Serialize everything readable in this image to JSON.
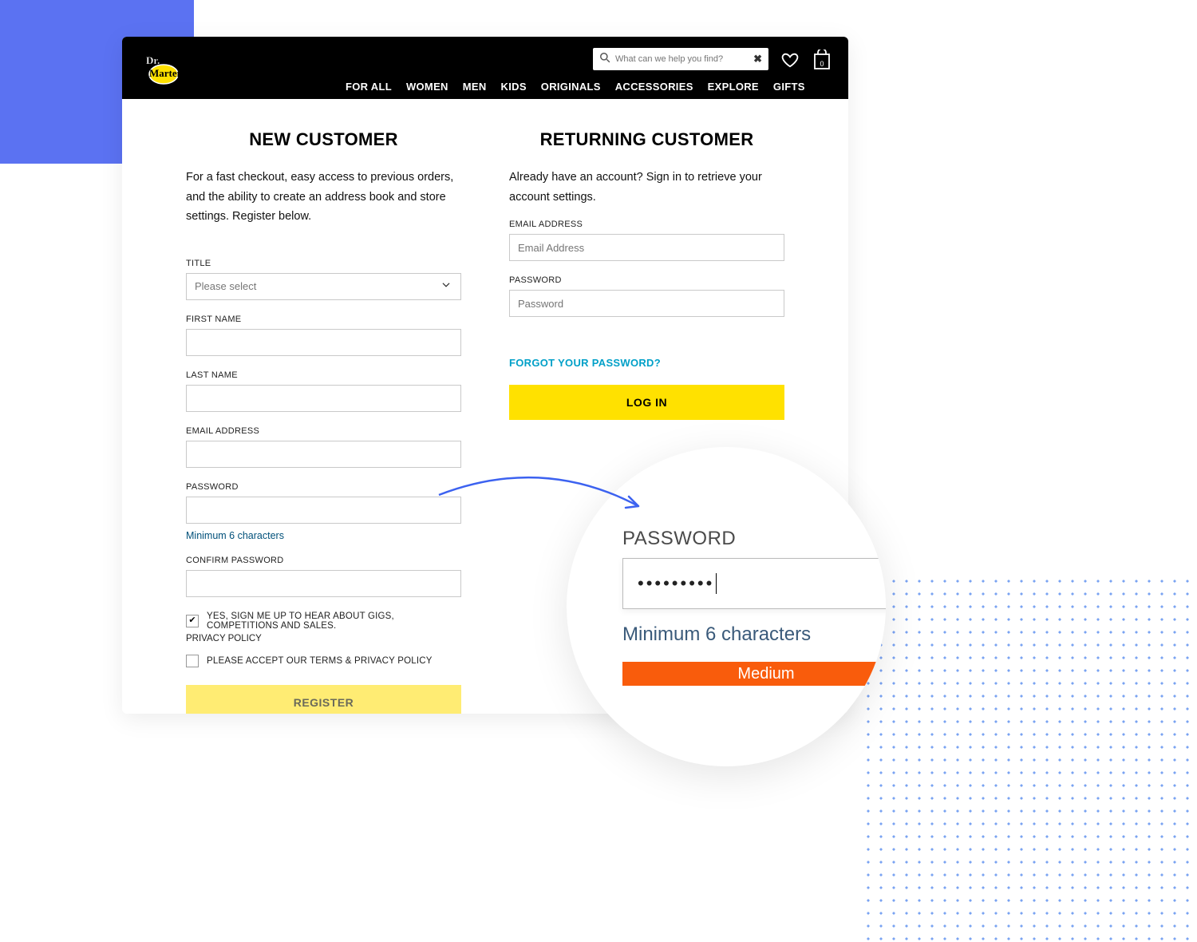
{
  "header": {
    "search_placeholder": "What can we help you find?",
    "bag_count": "0",
    "nav": [
      "FOR ALL",
      "WOMEN",
      "MEN",
      "KIDS",
      "ORIGINALS",
      "ACCESSORIES",
      "EXPLORE",
      "GIFTS"
    ]
  },
  "new_customer": {
    "title": "NEW CUSTOMER",
    "intro": "For a fast checkout, easy access to previous orders, and the ability to create an address book and store settings. Register below.",
    "fields": {
      "title_label": "TITLE",
      "title_placeholder": "Please select",
      "first_name_label": "FIRST NAME",
      "last_name_label": "LAST NAME",
      "email_label": "EMAIL ADDRESS",
      "password_label": "PASSWORD",
      "password_helper": "Minimum 6 characters",
      "confirm_password_label": "CONFIRM PASSWORD"
    },
    "checkbox_marketing": "YES, SIGN ME UP TO HEAR ABOUT GIGS, COMPETITIONS AND SALES.",
    "privacy_label": "PRIVACY POLICY",
    "checkbox_terms": "PLEASE ACCEPT OUR TERMS & PRIVACY POLICY",
    "register_button": "REGISTER"
  },
  "returning_customer": {
    "title": "RETURNING CUSTOMER",
    "intro": "Already have an account? Sign in to retrieve your account settings.",
    "email_label": "EMAIL ADDRESS",
    "email_placeholder": "Email Address",
    "password_label": "PASSWORD",
    "password_placeholder": "Password",
    "forgot": "FORGOT YOUR PASSWORD?",
    "login_button": "LOG IN"
  },
  "zoom": {
    "label": "PASSWORD",
    "dots": "•••••••••",
    "helper": "Minimum 6 characters",
    "strength": "Medium"
  }
}
